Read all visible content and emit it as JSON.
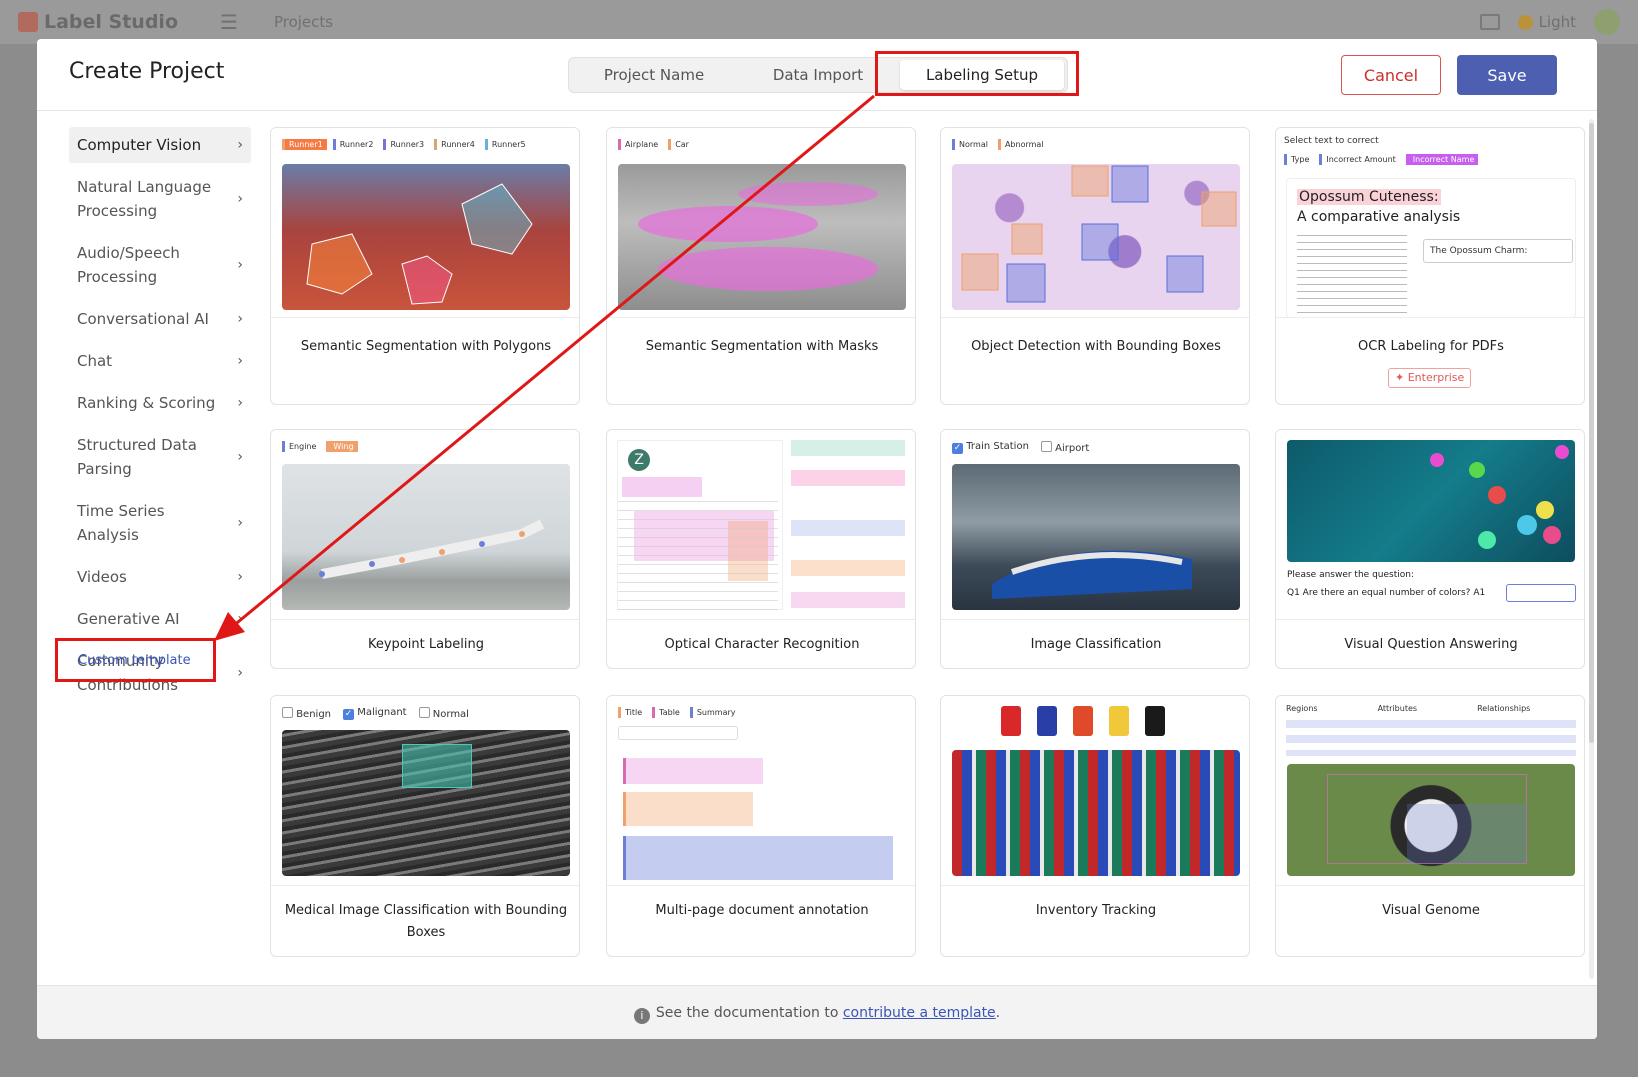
{
  "background": {
    "app_name": "Label Studio",
    "nav_item": "Projects",
    "theme_label": "Light"
  },
  "modal": {
    "title": "Create Project",
    "tabs": [
      {
        "label": "Project Name",
        "active": false
      },
      {
        "label": "Data Import",
        "active": false
      },
      {
        "label": "Labeling Setup",
        "active": true
      }
    ],
    "cancel_label": "Cancel",
    "save_label": "Save"
  },
  "sidebar": {
    "items": [
      {
        "label": "Computer Vision",
        "active": true
      },
      {
        "label": "Natural Language Processing",
        "active": false
      },
      {
        "label": "Audio/Speech Processing",
        "active": false
      },
      {
        "label": "Conversational AI",
        "active": false
      },
      {
        "label": "Chat",
        "active": false
      },
      {
        "label": "Ranking & Scoring",
        "active": false
      },
      {
        "label": "Structured Data Parsing",
        "active": false
      },
      {
        "label": "Time Series Analysis",
        "active": false
      },
      {
        "label": "Videos",
        "active": false
      },
      {
        "label": "Generative AI",
        "active": false
      },
      {
        "label": "Community Contributions",
        "active": false
      }
    ],
    "custom_template": "Custom template"
  },
  "cards": [
    {
      "title": "Semantic Segmentation with Polygons",
      "tags": [
        "Runner1",
        "Runner2",
        "Runner3",
        "Runner4",
        "Runner5"
      ]
    },
    {
      "title": "Semantic Segmentation with Masks",
      "tags": [
        "Airplane",
        "Car"
      ]
    },
    {
      "title": "Object Detection with Bounding Boxes",
      "tags": [
        "Normal",
        "Abnormal"
      ]
    },
    {
      "title": "OCR Labeling for PDFs",
      "tags": [
        "Type",
        "Incorrect Amount",
        "Incorrect Name"
      ],
      "badge": "Enterprise",
      "preview_title": "Opossum Cuteness:",
      "preview_sub": "A comparative analysis",
      "preview_header": "Select text to correct",
      "preview_field": "The Opossum Charm:"
    },
    {
      "title": "Keypoint Labeling",
      "tags": [
        "Engine",
        "Wing"
      ]
    },
    {
      "title": "Optical Character Recognition",
      "tags": []
    },
    {
      "title": "Image Classification",
      "tags": [
        "Train Station",
        "Airport"
      ]
    },
    {
      "title": "Visual Question Answering",
      "tags": [],
      "question_header": "Please answer the question:",
      "question": "Are there an equal number of colors?"
    },
    {
      "title": "Medical Image Classification with Bounding Boxes",
      "tags": [
        "Benign",
        "Malignant",
        "Normal"
      ]
    },
    {
      "title": "Multi-page document annotation",
      "tags": [
        "Title",
        "Table",
        "Summary"
      ]
    },
    {
      "title": "Inventory Tracking",
      "tags": []
    },
    {
      "title": "Visual Genome",
      "tags": [
        "Regions",
        "Attributes",
        "Relationships"
      ]
    }
  ],
  "footer": {
    "prefix": "See the documentation to",
    "link": "contribute a template",
    "suffix": "."
  },
  "colors": {
    "primary": "#4c5fb0",
    "danger": "#d9534f",
    "annotation_red": "#e01717"
  }
}
